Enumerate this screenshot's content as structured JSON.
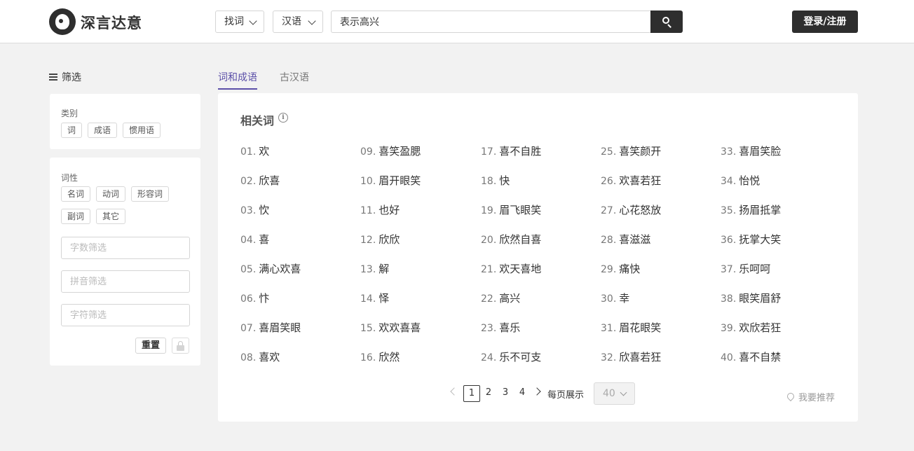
{
  "header": {
    "brand": "深言达意",
    "mode_select": "找词",
    "lang_select": "汉语",
    "search_value": "表示高兴",
    "login_label": "登录/注册"
  },
  "sidebar": {
    "title": "筛选",
    "category": {
      "label": "类别",
      "tags": [
        "词",
        "成语",
        "惯用语"
      ]
    },
    "pos": {
      "label": "词性",
      "tags": [
        "名词",
        "动词",
        "形容词",
        "副词",
        "其它"
      ]
    },
    "fields": {
      "char_count_placeholder": "字数筛选",
      "pinyin_placeholder": "拼音筛选",
      "char_placeholder": "字符筛选"
    },
    "reset_label": "重置"
  },
  "tabs": [
    {
      "label": "词和成语",
      "active": true
    },
    {
      "label": "古汉语",
      "active": false
    }
  ],
  "results": {
    "title": "相关词",
    "words": [
      {
        "num": "01.",
        "text": "欢"
      },
      {
        "num": "02.",
        "text": "欣喜"
      },
      {
        "num": "03.",
        "text": "忺"
      },
      {
        "num": "04.",
        "text": "喜"
      },
      {
        "num": "05.",
        "text": "满心欢喜"
      },
      {
        "num": "06.",
        "text": "忭"
      },
      {
        "num": "07.",
        "text": "喜眉笑眼"
      },
      {
        "num": "08.",
        "text": "喜欢"
      },
      {
        "num": "09.",
        "text": "喜笑盈腮"
      },
      {
        "num": "10.",
        "text": "眉开眼笑"
      },
      {
        "num": "11.",
        "text": "也好"
      },
      {
        "num": "12.",
        "text": "欣欣"
      },
      {
        "num": "13.",
        "text": "解"
      },
      {
        "num": "14.",
        "text": "怿"
      },
      {
        "num": "15.",
        "text": "欢欢喜喜"
      },
      {
        "num": "16.",
        "text": "欣然"
      },
      {
        "num": "17.",
        "text": "喜不自胜"
      },
      {
        "num": "18.",
        "text": "快"
      },
      {
        "num": "19.",
        "text": "眉飞眼笑"
      },
      {
        "num": "20.",
        "text": "欣然自喜"
      },
      {
        "num": "21.",
        "text": "欢天喜地"
      },
      {
        "num": "22.",
        "text": "高兴"
      },
      {
        "num": "23.",
        "text": "喜乐"
      },
      {
        "num": "24.",
        "text": "乐不可支"
      },
      {
        "num": "25.",
        "text": "喜笑颜开"
      },
      {
        "num": "26.",
        "text": "欢喜若狂"
      },
      {
        "num": "27.",
        "text": "心花怒放"
      },
      {
        "num": "28.",
        "text": "喜滋滋"
      },
      {
        "num": "29.",
        "text": "痛快"
      },
      {
        "num": "30.",
        "text": "幸"
      },
      {
        "num": "31.",
        "text": "眉花眼笑"
      },
      {
        "num": "32.",
        "text": "欣喜若狂"
      },
      {
        "num": "33.",
        "text": "喜眉笑脸"
      },
      {
        "num": "34.",
        "text": "怡悦"
      },
      {
        "num": "35.",
        "text": "扬眉抵掌"
      },
      {
        "num": "36.",
        "text": "抚掌大笑"
      },
      {
        "num": "37.",
        "text": "乐呵呵"
      },
      {
        "num": "38.",
        "text": "眼笑眉舒"
      },
      {
        "num": "39.",
        "text": "欢欣若狂"
      },
      {
        "num": "40.",
        "text": "喜不自禁"
      }
    ]
  },
  "pagination": {
    "pages": [
      "1",
      "2",
      "3",
      "4"
    ],
    "current": "1",
    "per_page_label": "每页展示",
    "per_page_value": "40"
  },
  "recommend_label": "我要推荐"
}
